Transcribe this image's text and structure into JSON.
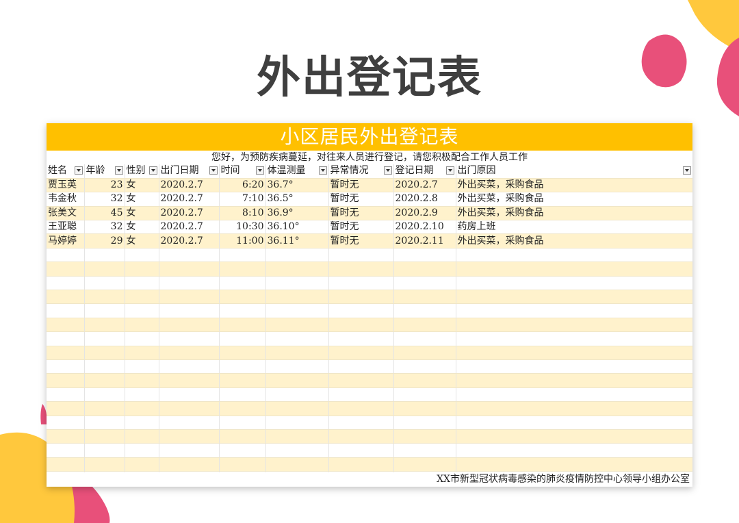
{
  "page_title": "外出登记表",
  "sheet": {
    "title": "小区居民外出登记表",
    "subtitle": "您好，为预防疾病蔓延，对往来人员进行登记，请您积极配合工作人员工作",
    "headers": [
      "姓名",
      "年龄",
      "性别",
      "出门日期",
      "时间",
      "体温测量",
      "异常情况",
      "登记日期",
      "出门原因"
    ],
    "rows": [
      [
        "贾玉英",
        "23",
        "女",
        "2020.2.7",
        "6:20",
        "36.7°",
        "暂时无",
        "2020.2.7",
        "外出买菜，采购食品"
      ],
      [
        "韦金秋",
        "32",
        "女",
        "2020.2.7",
        "7:10",
        "36.5°",
        "暂时无",
        "2020.2.8",
        "外出买菜，采购食品"
      ],
      [
        "张美文",
        "45",
        "女",
        "2020.2.7",
        "8:10",
        "36.9°",
        "暂时无",
        "2020.2.9",
        "外出买菜，采购食品"
      ],
      [
        "王亚聪",
        "32",
        "女",
        "2020.2.7",
        "10:30",
        "36.10°",
        "暂时无",
        "2020.2.10",
        "药房上班"
      ],
      [
        "马婷婷",
        "29",
        "女",
        "2020.2.7",
        "11:00",
        "36.11°",
        "暂时无",
        "2020.2.11",
        "外出买菜，采购食品"
      ]
    ],
    "footer": "XX市新型冠状病毒感染的肺炎疫情防控中心领导小组办公室"
  },
  "colors": {
    "accent": "#ffc000",
    "band": "#fff2cc",
    "deco_pink": "#e8507a",
    "deco_orange": "#ffc83d"
  }
}
